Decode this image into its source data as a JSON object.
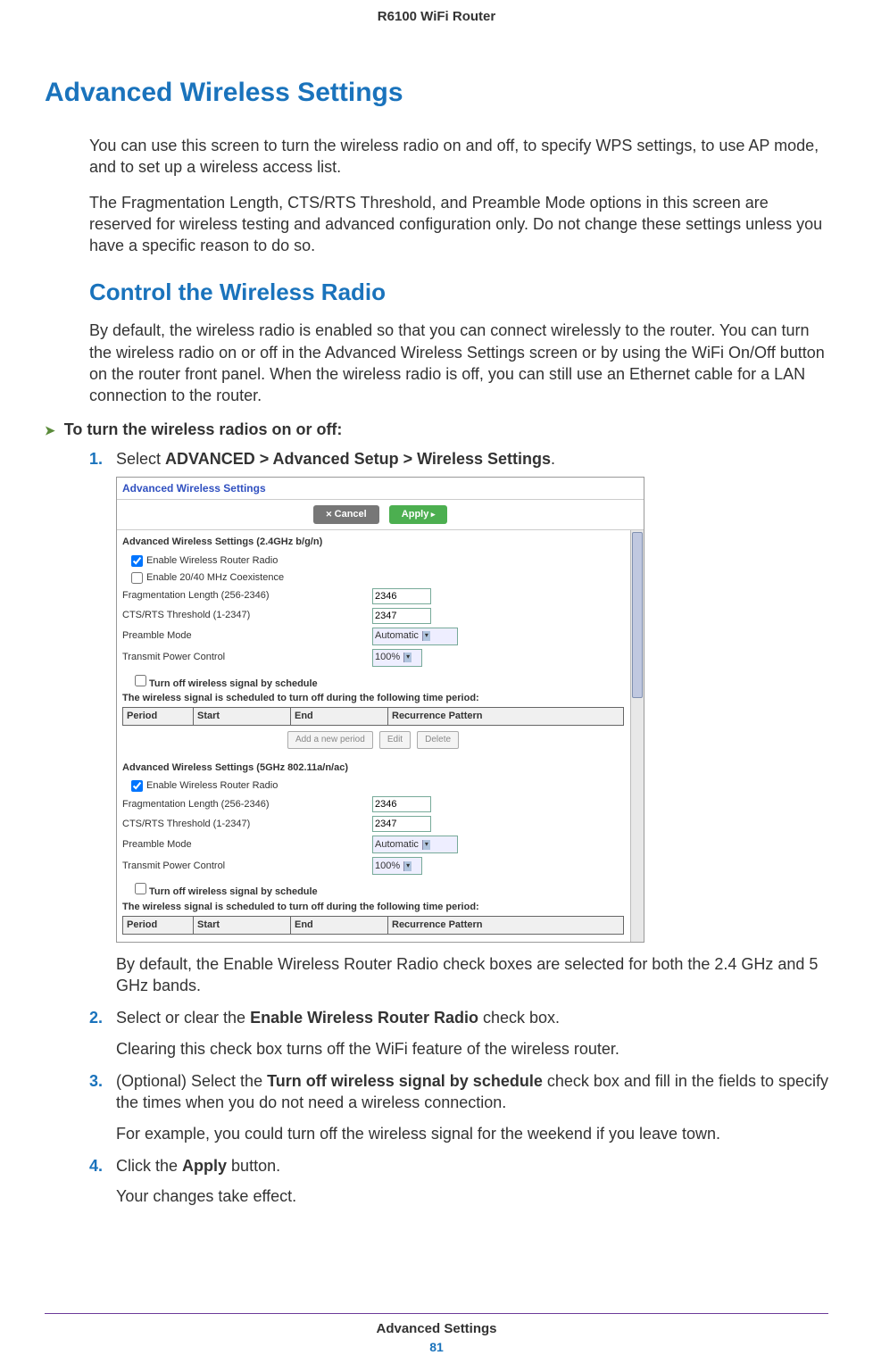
{
  "header": {
    "product": "R6100 WiFi Router"
  },
  "h1": "Advanced Wireless Settings",
  "intro1": "You can use this screen to turn the wireless radio on and off, to specify WPS settings, to use AP mode, and to set up a wireless access list.",
  "intro2": "The Fragmentation Length, CTS/RTS Threshold, and Preamble Mode options in this screen are reserved for wireless testing and advanced configuration only. Do not change these settings unless you have a specific reason to do so.",
  "h2": "Control the Wireless Radio",
  "radio_intro": "By default, the wireless radio is enabled so that you can connect wirelessly to the router. You can turn the wireless radio on or off in the Advanced Wireless Settings screen or by using the WiFi On/Off button on the router front panel. When the wireless radio is off, you can still use an Ethernet cable for a LAN connection to the router.",
  "procedure_title": "To turn the wireless radios on or off:",
  "steps": {
    "s1_pre": "Select ",
    "s1_bold": "ADVANCED > Advanced Setup > Wireless Settings",
    "s1_post": ".",
    "s1_note": "By default, the Enable Wireless Router Radio check boxes are selected for both the 2.4 GHz and 5 GHz bands.",
    "s2_pre": "Select or clear the ",
    "s2_bold": "Enable Wireless Router Radio",
    "s2_post": " check box.",
    "s2_note": "Clearing this check box turns off the WiFi feature of the wireless router.",
    "s3_pre": "(Optional) Select the ",
    "s3_bold": "Turn off wireless signal by schedule",
    "s3_post": " check box and fill in the fields to specify the times when you do not need a wireless connection.",
    "s3_note": "For example, you could turn off the wireless signal for the weekend if you leave town.",
    "s4_pre": "Click the ",
    "s4_bold": "Apply",
    "s4_post": " button.",
    "s4_note": "Your changes take effect."
  },
  "screenshot": {
    "title": "Advanced Wireless Settings",
    "cancel": "Cancel",
    "apply": "Apply",
    "section24": "Advanced Wireless Settings (2.4GHz b/g/n)",
    "section5": "Advanced Wireless Settings (5GHz 802.11a/n/ac)",
    "enable_radio": "Enable Wireless Router Radio",
    "enable_coex": "Enable 20/40 MHz Coexistence",
    "frag_label": "Fragmentation Length (256-2346)",
    "frag_value": "2346",
    "cts_label": "CTS/RTS Threshold (1-2347)",
    "cts_value": "2347",
    "preamble_label": "Preamble Mode",
    "preamble_value": "Automatic",
    "txpower_label": "Transmit Power Control",
    "txpower_value": "100%",
    "schedule_check": "Turn off wireless signal by schedule",
    "schedule_note": "The wireless signal is scheduled to turn off during the following time period:",
    "table": {
      "c1": "Period",
      "c2": "Start",
      "c3": "End",
      "c4": "Recurrence Pattern"
    },
    "btn_add": "Add a new period",
    "btn_edit": "Edit",
    "btn_delete": "Delete"
  },
  "footer": {
    "section": "Advanced Settings",
    "page": "81"
  }
}
